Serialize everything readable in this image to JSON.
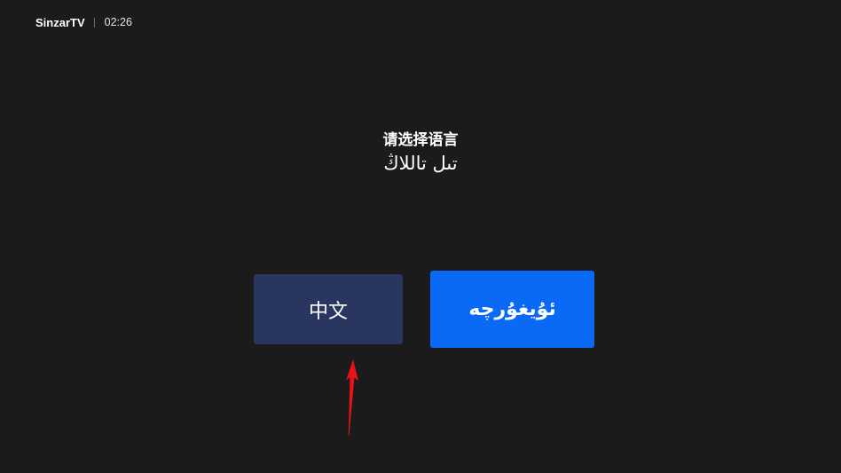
{
  "topbar": {
    "brand": "SinzarTV",
    "time": "02:26"
  },
  "prompt": {
    "chinese": "请选择语言",
    "uyghur": "تىل تاللاڭ"
  },
  "languages": [
    {
      "label": "中文",
      "focused": false
    },
    {
      "label": "ئۇيغۇرچە",
      "focused": true
    }
  ],
  "colors": {
    "background": "#1b1b1c",
    "button_default": "#283660",
    "button_focused": "#0a6af5",
    "annotation_arrow": "#e8121b"
  }
}
